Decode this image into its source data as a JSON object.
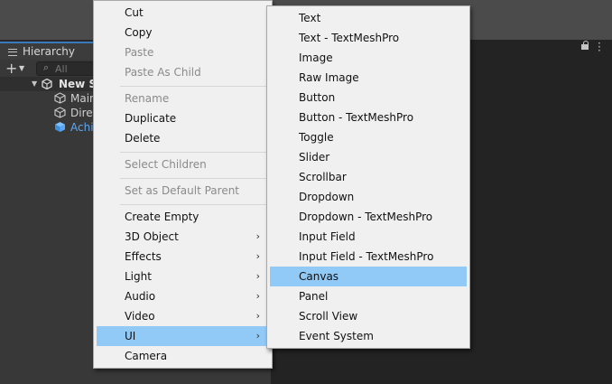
{
  "hierarchy": {
    "tab_label": "Hierarchy",
    "search_placeholder": "All",
    "add_label": "+",
    "scene_name": "New S",
    "items": [
      "Main",
      "Direc",
      "Achi"
    ]
  },
  "context_menu": {
    "items": [
      {
        "label": "Cut",
        "enabled": true
      },
      {
        "label": "Copy",
        "enabled": true
      },
      {
        "label": "Paste",
        "enabled": false
      },
      {
        "label": "Paste As Child",
        "enabled": false
      },
      {
        "label": "Rename",
        "enabled": false
      },
      {
        "label": "Duplicate",
        "enabled": true
      },
      {
        "label": "Delete",
        "enabled": true
      },
      {
        "label": "Select Children",
        "enabled": false
      },
      {
        "label": "Set as Default Parent",
        "enabled": false
      },
      {
        "label": "Create Empty",
        "enabled": true
      },
      {
        "label": "3D Object",
        "enabled": true,
        "submenu": true
      },
      {
        "label": "Effects",
        "enabled": true,
        "submenu": true
      },
      {
        "label": "Light",
        "enabled": true,
        "submenu": true
      },
      {
        "label": "Audio",
        "enabled": true,
        "submenu": true
      },
      {
        "label": "Video",
        "enabled": true,
        "submenu": true
      },
      {
        "label": "UI",
        "enabled": true,
        "submenu": true,
        "highlighted": true
      },
      {
        "label": "Camera",
        "enabled": true
      }
    ]
  },
  "ui_submenu": {
    "items": [
      {
        "label": "Text"
      },
      {
        "label": "Text - TextMeshPro"
      },
      {
        "label": "Image"
      },
      {
        "label": "Raw Image"
      },
      {
        "label": "Button"
      },
      {
        "label": "Button - TextMeshPro"
      },
      {
        "label": "Toggle"
      },
      {
        "label": "Slider"
      },
      {
        "label": "Scrollbar"
      },
      {
        "label": "Dropdown"
      },
      {
        "label": "Dropdown - TextMeshPro"
      },
      {
        "label": "Input Field"
      },
      {
        "label": "Input Field - TextMeshPro"
      },
      {
        "label": "Canvas",
        "highlighted": true
      },
      {
        "label": "Panel"
      },
      {
        "label": "Scroll View"
      },
      {
        "label": "Event System"
      }
    ]
  },
  "colors": {
    "highlight": "#91c9f7",
    "selected_object_text": "#5aa7f5",
    "tab_accent": "#3a79bb"
  }
}
